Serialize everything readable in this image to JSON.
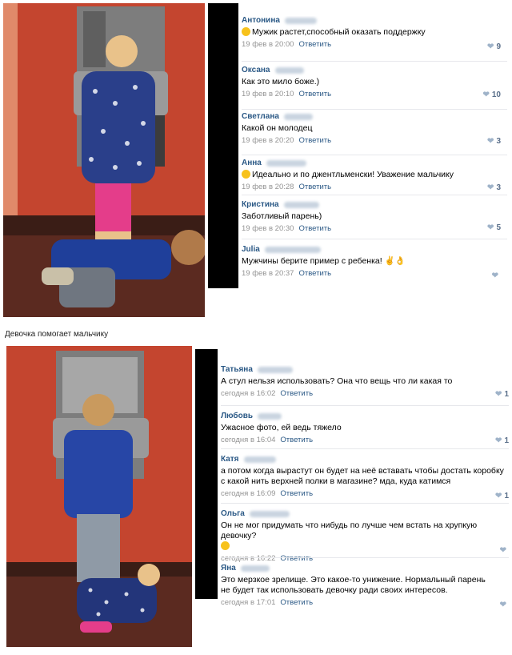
{
  "post": {
    "caption": "Девочка помогает мальчику"
  },
  "top_comments": [
    {
      "name": "Антонина",
      "text": "Мужик растет,способный оказать поддержку",
      "emoji": true,
      "time": "19 фев в 20:00",
      "reply": "Ответить",
      "likes": "9"
    },
    {
      "name": "Оксана",
      "text": "Как это мило боже.)",
      "emoji": false,
      "time": "19 фев в 20:10",
      "reply": "Ответить",
      "likes": "10"
    },
    {
      "name": "Светлана",
      "text": "Какой он молодец",
      "emoji": false,
      "time": "19 фев в 20:20",
      "reply": "Ответить",
      "likes": "3"
    },
    {
      "name": "Анна",
      "text": "Идеально и по джентльменски! Уважение мальчику",
      "emoji": true,
      "time": "19 фев в 20:28",
      "reply": "Ответить",
      "likes": "3"
    },
    {
      "name": "Кристина",
      "text": "Заботливый парень)",
      "emoji": false,
      "time": "19 фев в 20:30",
      "reply": "Ответить",
      "likes": "5"
    },
    {
      "name": "Julia",
      "text": "Мужчины берите пример с ребенка! ✌👌",
      "emoji": false,
      "time": "19 фев в 20:37",
      "reply": "Ответить",
      "likes": ""
    }
  ],
  "bottom_comments": [
    {
      "name": "Татьяна",
      "text": "А стул нельзя использовать? Она что вещь что ли какая то",
      "time": "сегодня в 16:02",
      "reply": "Ответить",
      "likes": "1"
    },
    {
      "name": "Любовь",
      "text": "Ужасное фото, ей ведь тяжело",
      "time": "сегодня в 16:04",
      "reply": "Ответить",
      "likes": "1"
    },
    {
      "name": "Катя",
      "text": "а потом когда вырастут он будет на неё вставать чтобы достать коробку с какой нить верхней полки в магазине? мда, куда катимся",
      "time": "сегодня в 16:09",
      "reply": "Ответить",
      "likes": "1"
    },
    {
      "name": "Ольга",
      "text": "Он не мог придумать что нибудь по лучше чем встать на хрупкую девочку?",
      "time": "сегодня в 16:22",
      "reply": "Ответить",
      "likes": "",
      "emoji_line": true
    },
    {
      "name": "Яна",
      "text": "Это мерзкое зрелище. Это какое-то унижение. Нормальный парень не будет так использовать девочку ради своих интересов.",
      "time": "сегодня в 17:01",
      "reply": "Ответить",
      "likes": ""
    }
  ],
  "colors": {
    "name": "#2a5885",
    "meta": "#939393",
    "wall": "#c9472e",
    "floor": "#6b2e24"
  }
}
